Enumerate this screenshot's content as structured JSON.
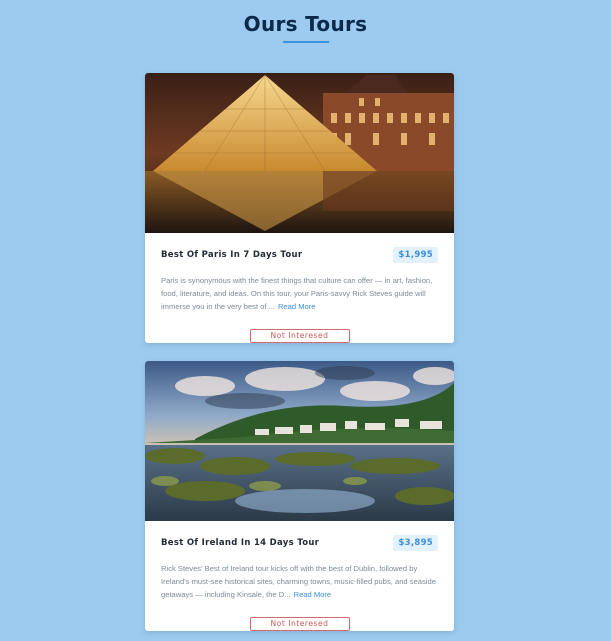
{
  "page": {
    "title": "Ours Tours"
  },
  "tours": [
    {
      "name": "Best Of Paris In 7 Days Tour",
      "price": "$1,995",
      "info": "Paris is synonymous with the finest things that culture can offer — in art, fashion, food, literature, and ideas. On this tour, your Paris-savvy Rick Steves guide will immerse you in the very best of ...",
      "read_more": "Read More",
      "button_label": "Not Interesed",
      "image": "paris-louvre-pyramid-photo"
    },
    {
      "name": "Best Of Ireland In 14 Days Tour",
      "price": "$3,895",
      "info": "Rick Steves' Best of Ireland tour kicks off with the best of Dublin, followed by Ireland's must-see historical sites, charming towns, music-filled pubs, and seaside getaways — including Kinsale, the D...",
      "read_more": "Read More",
      "button_label": "Not Interesed",
      "image": "ireland-coast-photo"
    }
  ],
  "colors": {
    "background": "#9ccbef",
    "accent": "#3a92e0",
    "title": "#0b2a4a",
    "price_bg": "#e2f1fb",
    "price_text": "#3a8fd8",
    "button_border": "#d36b6b"
  }
}
